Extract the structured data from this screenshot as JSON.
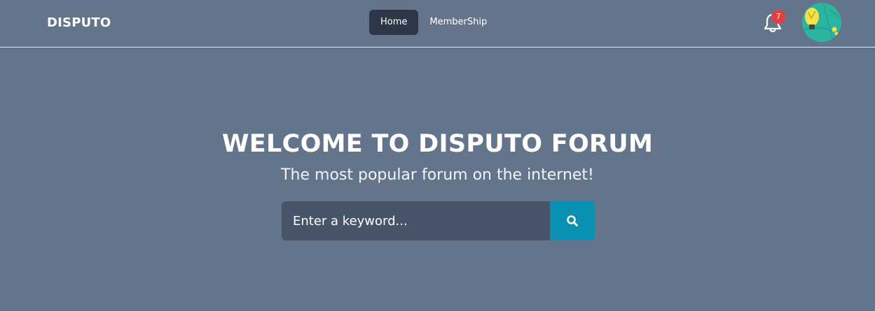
{
  "navbar": {
    "brand": "DISPUTO",
    "links": [
      {
        "label": "Home",
        "active": true
      },
      {
        "label": "MemberShip",
        "active": false
      }
    ],
    "notifications": {
      "icon": "bell-icon",
      "count": "7"
    },
    "avatar": {
      "icon": "avatar-lightbulb-icon"
    }
  },
  "hero": {
    "title": "WELCOME TO DISPUTO FORUM",
    "subtitle": "The most popular forum on the internet!"
  },
  "search": {
    "placeholder": "Enter a keyword...",
    "button_icon": "search-icon"
  },
  "colors": {
    "background": "#64748b",
    "active_link": "#2d3748",
    "search_input": "#475569",
    "search_button": "#0891b2",
    "badge": "#e53e3e",
    "avatar": "#2bb5a0"
  }
}
